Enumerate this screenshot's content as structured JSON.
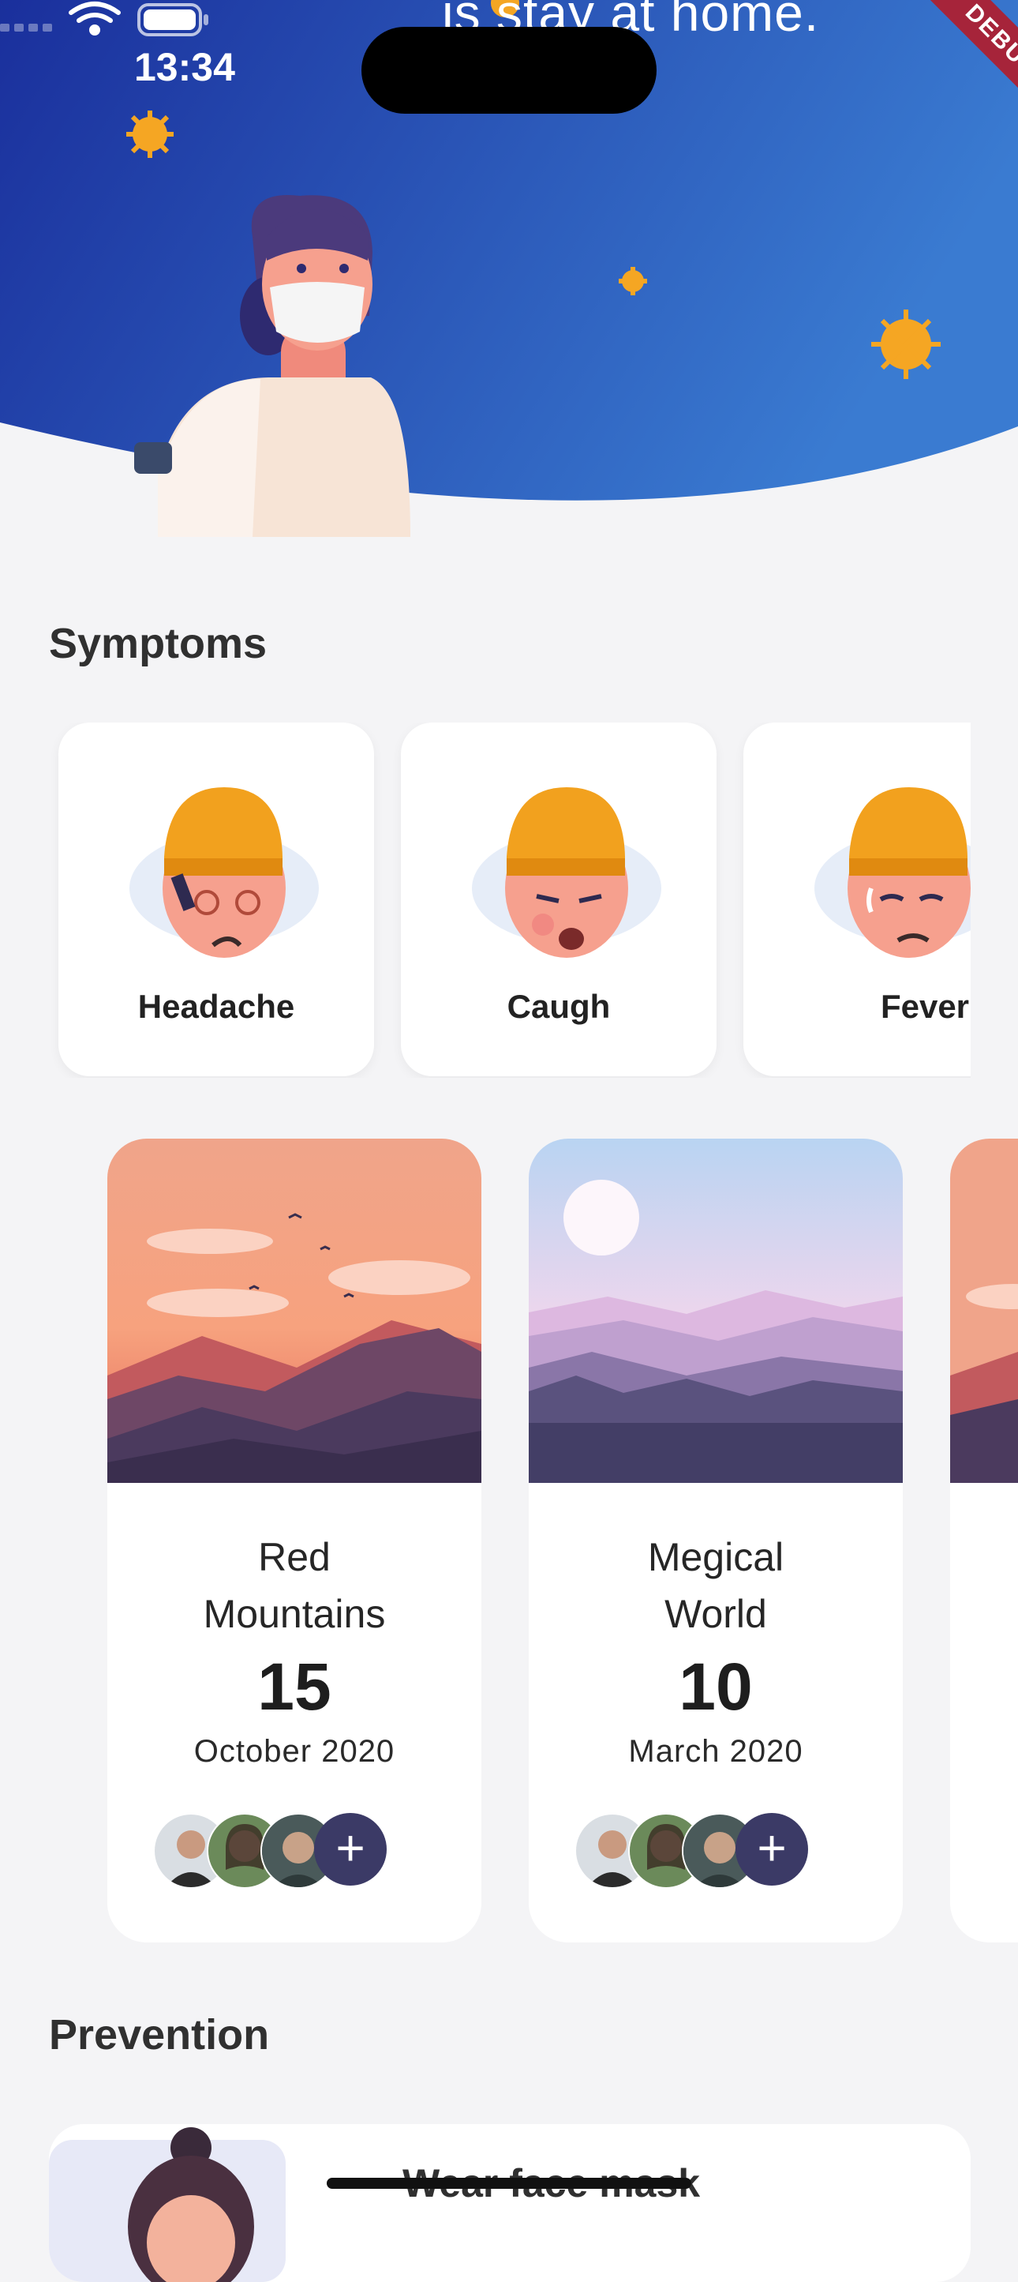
{
  "header": {
    "text": "is stay at home.",
    "colors": {
      "gradient_start": "#1a2f9c",
      "gradient_end": "#3a7bd1",
      "virus": "#f5a623"
    }
  },
  "status_bar": {
    "time": "13:34",
    "icons": [
      "signal-icon",
      "wifi-icon",
      "battery-icon"
    ]
  },
  "debug_banner": "DEBUG",
  "symptoms": {
    "title": "Symptoms",
    "items": [
      {
        "label": "Headache"
      },
      {
        "label": "Caugh"
      },
      {
        "label": "Fever"
      }
    ]
  },
  "events": [
    {
      "title_line1": "Red",
      "title_line2": "Mountains",
      "day": "15",
      "month": "October 2020"
    },
    {
      "title_line1": "Megical",
      "title_line2": "World",
      "day": "10",
      "month": "March 2020"
    }
  ],
  "add_label": "+",
  "prevention": {
    "title": "Prevention",
    "items": [
      {
        "label": "Wear face mask"
      }
    ]
  }
}
